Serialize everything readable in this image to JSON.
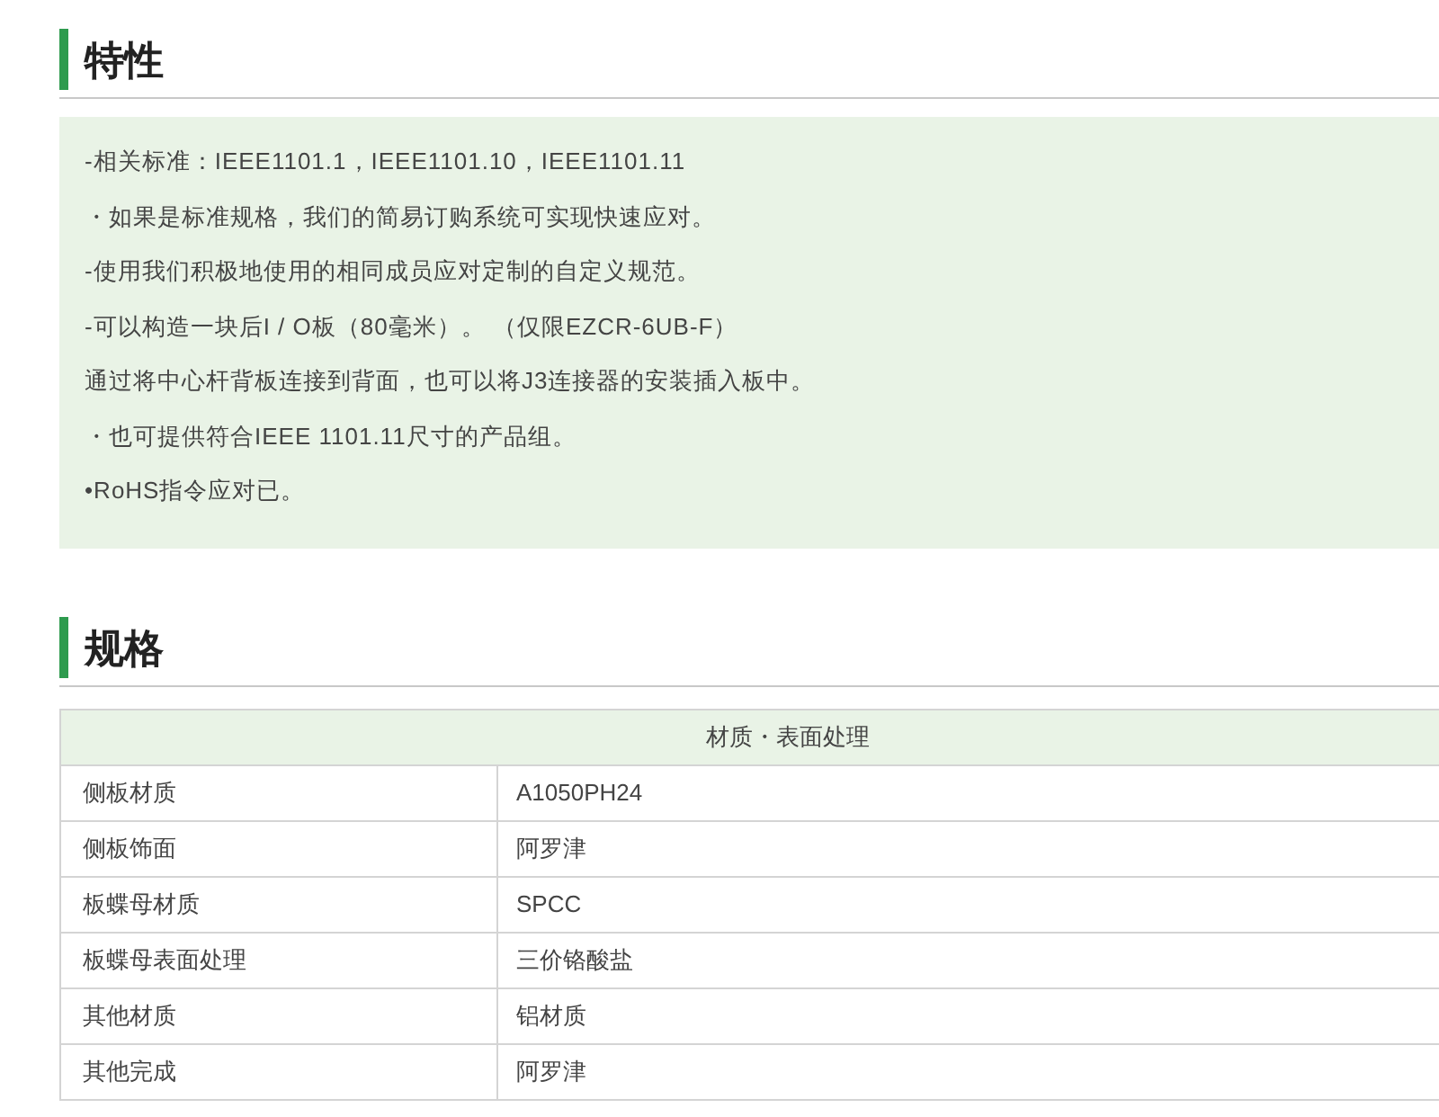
{
  "features": {
    "heading": "特性",
    "lines": [
      "-相关标准：IEEE1101.1，IEEE1101.10，IEEE1101.11",
      "・如果是标准规格，我们的简易订购系统可实现快速应对。",
      "-使用我们积极地使用的相同成员应对定制的自定义规范。",
      "-可以构造一块后I / O板（80毫米）。 （仅限EZCR-6UB-F）",
      "通过将中心杆背板连接到背面，也可以将J3连接器的安装插入板中。",
      "・也可提供符合IEEE 1101.11尺寸的产品组。",
      "•RoHS指令应对已。"
    ]
  },
  "specs": {
    "heading": "规格",
    "table": {
      "header": "材质・表面处理",
      "rows": [
        {
          "label": "侧板材质",
          "value": "A1050PH24"
        },
        {
          "label": "侧板饰面",
          "value": "阿罗津"
        },
        {
          "label": "板蝶母材质",
          "value": "SPCC"
        },
        {
          "label": "板蝶母表面处理",
          "value": "三价铬酸盐"
        },
        {
          "label": "其他材质",
          "value": "铝材质"
        },
        {
          "label": "其他完成",
          "value": "阿罗津"
        }
      ]
    }
  }
}
